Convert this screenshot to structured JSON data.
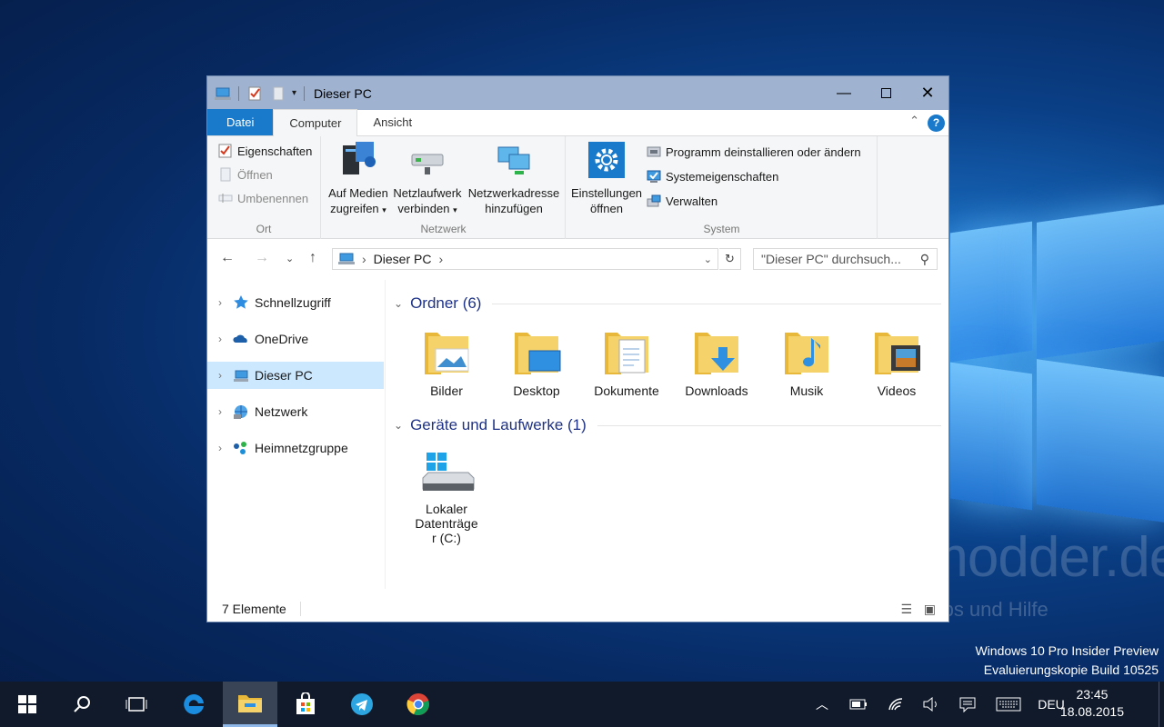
{
  "window": {
    "title": "Dieser PC",
    "minimize_icon": "minimize-icon",
    "maximize_icon": "maximize-icon",
    "close_icon": "close-icon"
  },
  "ribbon": {
    "tabs": [
      {
        "label": "Datei"
      },
      {
        "label": "Computer"
      },
      {
        "label": "Ansicht"
      }
    ],
    "groups": {
      "ort": {
        "label": "Ort",
        "items": [
          {
            "label": "Eigenschaften"
          },
          {
            "label": "Öffnen"
          },
          {
            "label": "Umbenennen"
          }
        ]
      },
      "netzwerk": {
        "label": "Netzwerk",
        "items": [
          {
            "line1": "Auf Medien",
            "line2": "zugreifen"
          },
          {
            "line1": "Netzlaufwerk",
            "line2": "verbinden"
          },
          {
            "line1": "Netzwerkadresse",
            "line2": "hinzufügen"
          }
        ]
      },
      "system": {
        "label": "System",
        "settings": {
          "line1": "Einstellungen",
          "line2": "öffnen"
        },
        "items": [
          {
            "label": "Programm deinstallieren oder ändern"
          },
          {
            "label": "Systemeigenschaften"
          },
          {
            "label": "Verwalten"
          }
        ]
      }
    }
  },
  "addressbar": {
    "path": "Dieser PC",
    "search_placeholder": "\"Dieser PC\" durchsuch..."
  },
  "navpane": {
    "items": [
      {
        "label": "Schnellzugriff"
      },
      {
        "label": "OneDrive"
      },
      {
        "label": "Dieser PC"
      },
      {
        "label": "Netzwerk"
      },
      {
        "label": "Heimnetzgruppe"
      }
    ]
  },
  "content": {
    "folders_header": "Ordner (6)",
    "folders": [
      {
        "label": "Bilder"
      },
      {
        "label": "Desktop"
      },
      {
        "label": "Dokumente"
      },
      {
        "label": "Downloads"
      },
      {
        "label": "Musik"
      },
      {
        "label": "Videos"
      }
    ],
    "drives_header": "Geräte und Laufwerke (1)",
    "drives": [
      {
        "line1": "Lokaler",
        "line2": "Datenträge",
        "line3": "r (C:)"
      }
    ]
  },
  "statusbar": {
    "text": "7 Elemente"
  },
  "desktop": {
    "watermark": "Deskmodder.de",
    "watermark_sub": "News, Tipps und Hilfe",
    "build_line1": "Windows 10 Pro Insider Preview",
    "build_line2": "Evaluierungskopie Build 10525"
  },
  "taskbar": {
    "language": "DEU",
    "time": "23:45",
    "date": "18.08.2015",
    "apps": [
      "start-icon",
      "search-icon",
      "task-view-icon",
      "edge-icon",
      "file-explorer-icon",
      "store-icon",
      "telegram-icon",
      "chrome-icon"
    ]
  }
}
